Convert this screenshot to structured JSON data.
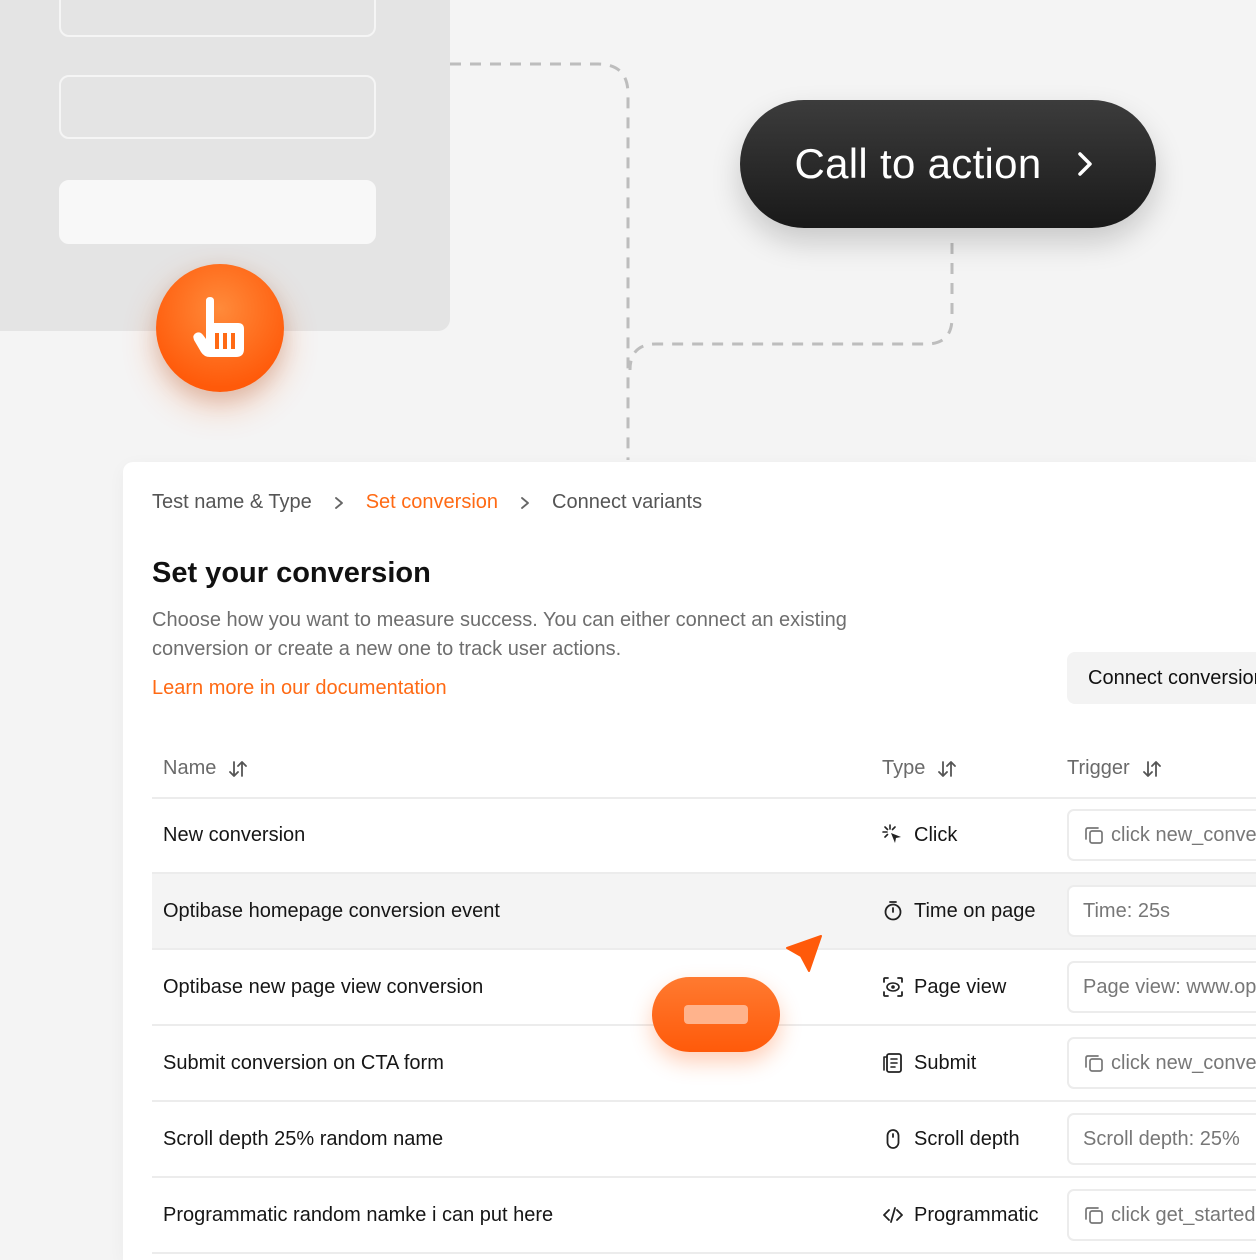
{
  "colors": {
    "accent": "#ff6a14",
    "cta_bg": "#262626",
    "background": "#f4f4f4"
  },
  "hero": {
    "cta_label": "Call to action",
    "cta_icon": "chevron-right-icon",
    "hand_icon": "pointer-hand-icon"
  },
  "panel": {
    "breadcrumb": [
      "Test name & Type",
      "Set conversion",
      "Connect variants"
    ],
    "title": "Set your conversion",
    "description": "Choose how you want to measure success. You can either connect an existing conversion or create a new one to track user actions.",
    "doc_link": "Learn more in our documentation",
    "connect_button": "Connect conversion",
    "table": {
      "headers": {
        "name": "Name",
        "type": "Type",
        "trigger": "Trigger"
      },
      "rows": [
        {
          "name": "New conversion",
          "type": "Click",
          "type_icon": "click-icon",
          "trigger": "click new_conversion",
          "trigger_icon": "copy-icon"
        },
        {
          "name": "Optibase homepage conversion event",
          "type": "Time on page",
          "type_icon": "timer-icon",
          "trigger": "Time: 25s",
          "trigger_icon": ""
        },
        {
          "name": "Optibase new page view conversion",
          "type": "Page view",
          "type_icon": "page-view-icon",
          "trigger": "Page view: www.optibase.io",
          "trigger_icon": ""
        },
        {
          "name": "Submit conversion on CTA form",
          "type": "Submit",
          "type_icon": "form-submit-icon",
          "trigger": "click new_conversion",
          "trigger_icon": "copy-icon"
        },
        {
          "name": "Scroll depth 25% random name",
          "type": "Scroll depth",
          "type_icon": "mouse-icon",
          "trigger": "Scroll depth: 25%",
          "trigger_icon": ""
        },
        {
          "name": "Programmatic random namke i can put here",
          "type": "Programmatic",
          "type_icon": "code-icon",
          "trigger": "click get_started",
          "trigger_icon": "copy-icon"
        }
      ]
    }
  }
}
